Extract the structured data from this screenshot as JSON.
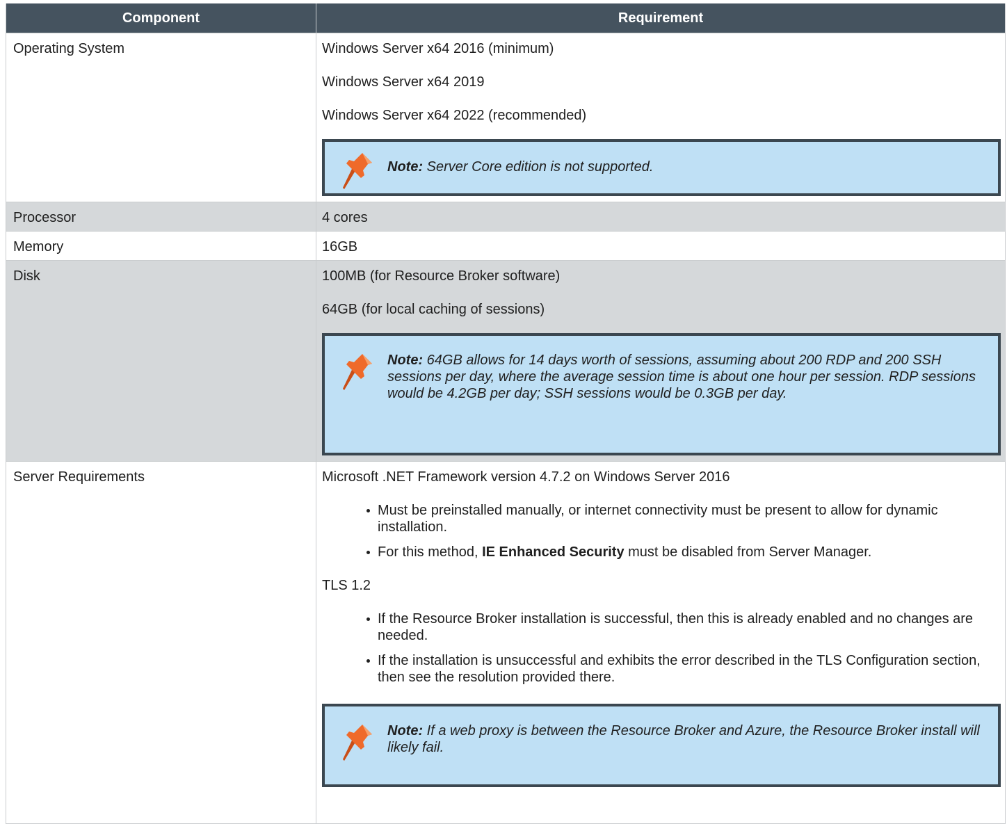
{
  "headers": {
    "component": "Component",
    "requirement": "Requirement"
  },
  "rows": {
    "os": {
      "component": "Operating System",
      "lines": [
        "Windows Server x64 2016 (minimum)",
        "Windows Server x64 2019",
        "Windows Server x64 2022 (recommended)"
      ],
      "note_label": "Note:",
      "note_text": " Server Core edition is not supported."
    },
    "processor": {
      "component": "Processor",
      "value": "4 cores"
    },
    "memory": {
      "component": "Memory",
      "value": "16GB"
    },
    "disk": {
      "component": "Disk",
      "lines": [
        "100MB (for Resource Broker software)",
        "64GB (for local caching of sessions)"
      ],
      "note_label": "Note:",
      "note_text": " 64GB allows for 14 days worth of sessions, assuming about 200 RDP and 200 SSH sessions per day, where the average session time is about one hour per session. RDP sessions would be 4.2GB per day; SSH sessions would be 0.3GB per day."
    },
    "server": {
      "component": "Server Requirements",
      "net_line": "Microsoft .NET Framework version 4.7.2 on Windows Server 2016",
      "net_bullet1": "Must be preinstalled manually, or internet connectivity must be present to allow for dynamic installation.",
      "net_bullet2_pre": "For this method, ",
      "net_bullet2_bold": "IE Enhanced Security",
      "net_bullet2_post": " must be disabled from Server Manager.",
      "tls_line": "TLS 1.2",
      "tls_bullet1": "If the Resource Broker installation is successful, then this is already enabled and no changes are needed.",
      "tls_bullet2": "If the installation is unsuccessful and exhibits the error described in the TLS Configuration section, then see the resolution provided there.",
      "note_label": "Note:",
      "note_text": " If a web proxy is between the Resource Broker and Azure, the Resource Broker install will likely fail."
    }
  },
  "colors": {
    "header_bg": "#45535f",
    "shade_row": "#d5d8da",
    "note_bg": "#bfe0f5",
    "note_border": "#3b4750",
    "pin": "#ef6a2a"
  },
  "icons": {
    "note_icon": "pushpin-icon"
  }
}
